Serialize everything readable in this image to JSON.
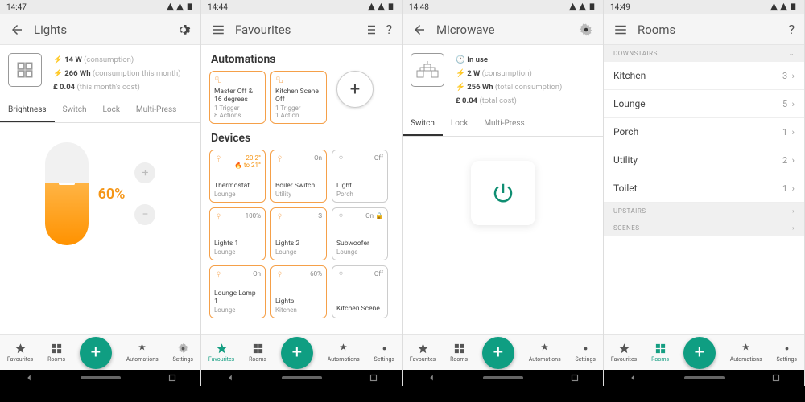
{
  "screens": [
    {
      "time": "14:47",
      "title": "Lights",
      "back": true,
      "gear": true
    },
    {
      "time": "14:44",
      "title": "Favourites",
      "menu": true,
      "list": true,
      "help": true
    },
    {
      "time": "14:48",
      "title": "Microwave",
      "back": true,
      "gear": true
    },
    {
      "time": "14:49",
      "title": "Rooms",
      "menu": true,
      "help": true
    }
  ],
  "lights": {
    "stats": [
      {
        "icon": "power",
        "val": "14 W",
        "lbl": "(consumption)"
      },
      {
        "icon": "power",
        "val": "266 Wh",
        "lbl": "(consumption this month)"
      },
      {
        "icon": "cost",
        "val": "£ 0.04",
        "lbl": "(this month's cost)"
      }
    ],
    "tabs": [
      "Brightness",
      "Switch",
      "Lock",
      "Multi-Press"
    ],
    "active": 0,
    "pct": "60%"
  },
  "fav": {
    "h1": "Automations",
    "autos": [
      {
        "name": "Master Off & 16 degrees",
        "d1": "1 Trigger",
        "d2": "8 Actions"
      },
      {
        "name": "Kitchen Scene Off",
        "d1": "1 Trigger",
        "d2": "1 Action"
      }
    ],
    "h2": "Devices",
    "devices": [
      {
        "name": "Thermostat",
        "sub": "Lounge",
        "r": "20.2°",
        "r2": "to 21°",
        "o": true
      },
      {
        "name": "Boiler Switch",
        "sub": "Utility",
        "r": "On",
        "o": true
      },
      {
        "name": "Light",
        "sub": "Porch",
        "r": "Off"
      },
      {
        "name": "Lights 1",
        "sub": "Lounge",
        "r": "100%",
        "o": true
      },
      {
        "name": "Lights 2",
        "sub": "Lounge",
        "r": "S",
        "o": true
      },
      {
        "name": "Subwoofer",
        "sub": "Lounge",
        "r": "On",
        "lock": true
      },
      {
        "name": "Lounge Lamp 1",
        "sub": "Lounge",
        "r": "On",
        "o": true
      },
      {
        "name": "Lights",
        "sub": "Kitchen",
        "r": "60%",
        "o": true
      },
      {
        "name": "Kitchen Scene",
        "sub": "",
        "r": "Off"
      }
    ]
  },
  "micro": {
    "stats": [
      {
        "icon": "clock",
        "val": "In use",
        "lbl": ""
      },
      {
        "icon": "power",
        "val": "2 W",
        "lbl": "(consumption)"
      },
      {
        "icon": "power",
        "val": "256 Wh",
        "lbl": "(total consumption)"
      },
      {
        "icon": "cost",
        "val": "£ 0.04",
        "lbl": "(total cost)"
      }
    ],
    "tabs": [
      "Switch",
      "Lock",
      "Multi-Press"
    ],
    "active": 0
  },
  "rooms": {
    "groups": [
      {
        "name": "DOWNSTAIRS",
        "open": true,
        "rooms": [
          {
            "n": "Kitchen",
            "c": 3
          },
          {
            "n": "Lounge",
            "c": 5
          },
          {
            "n": "Porch",
            "c": 1
          },
          {
            "n": "Utility",
            "c": 2
          },
          {
            "n": "Toilet",
            "c": 1
          }
        ]
      },
      {
        "name": "UPSTAIRS",
        "open": false
      },
      {
        "name": "SCENES",
        "open": false
      }
    ]
  },
  "nav": [
    "Favourites",
    "Rooms",
    "",
    "Automations",
    "Settings"
  ]
}
